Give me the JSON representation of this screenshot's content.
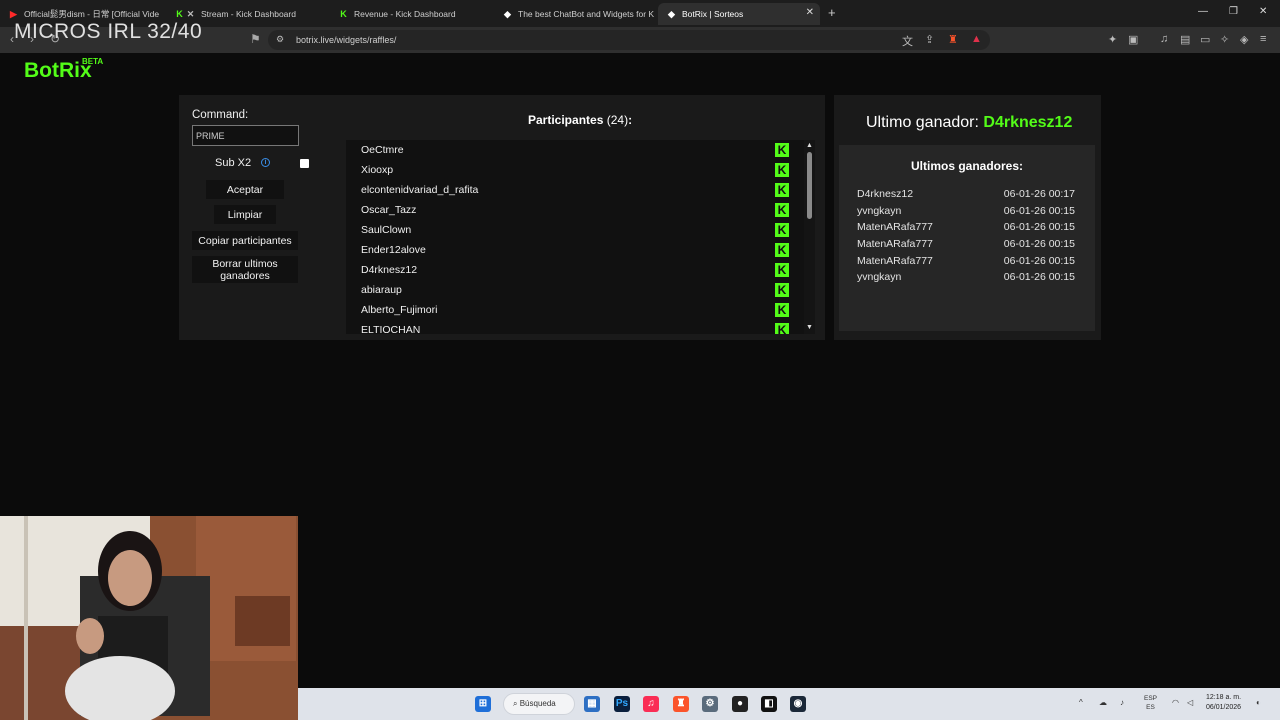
{
  "overlay_title": "MICROS IRL 32/40",
  "browser": {
    "tabs": [
      {
        "title": "Official髭男dism - 日常 [Official Vide"
      },
      {
        "title": "Stream - Kick Dashboard"
      },
      {
        "title": "Revenue - Kick Dashboard"
      },
      {
        "title": "The best ChatBot and Widgets for Ki"
      },
      {
        "title": "BotRix | Sorteos"
      }
    ],
    "url": "botrix.live/widgets/raffles/"
  },
  "header": {
    "logo": "BotRix",
    "badge": "BETA"
  },
  "controls": {
    "command_label": "Command:",
    "command_value": "PRIME",
    "sub_x2_label": "Sub X2",
    "accept_label": "Aceptar",
    "clear_label": "Limpiar",
    "copy_label": "Copiar participantes",
    "delete_label": "Borrar ultimos ganadores"
  },
  "participants": {
    "title": "Participantes",
    "count": "(24)",
    "colon": ":",
    "items": [
      "OeCtmre",
      "Xiooxp",
      "elcontenidvariad_d_rafita",
      "Oscar_Tazz",
      "SaulClown",
      "Ender12alove",
      "D4rknesz12",
      "abiaraup",
      "Alberto_Fujimori",
      "ELTIOCHAN"
    ]
  },
  "winner": {
    "label": "Ultimo ganador:",
    "name": "D4rknesz12"
  },
  "recent_winners": {
    "title": "Ultimos ganadores:",
    "rows": [
      {
        "name": "D4rknesz12",
        "date": "06-01-26 00:17"
      },
      {
        "name": "yvngkayn",
        "date": "06-01-26 00:15"
      },
      {
        "name": "MatenARafa777",
        "date": "06-01-26 00:15"
      },
      {
        "name": "MatenARafa777",
        "date": "06-01-26 00:15"
      },
      {
        "name": "MatenARafa777",
        "date": "06-01-26 00:15"
      },
      {
        "name": "yvngkayn",
        "date": "06-01-26 00:15"
      }
    ]
  },
  "taskbar": {
    "search_label": "Búsqueda",
    "lang_top": "ESP",
    "lang_bottom": "ES",
    "time": "12:18 a. m.",
    "date": "06/01/2026"
  },
  "colors": {
    "accent": "#53fc18",
    "panel": "#1a1a1a",
    "list_bg": "#111111"
  }
}
